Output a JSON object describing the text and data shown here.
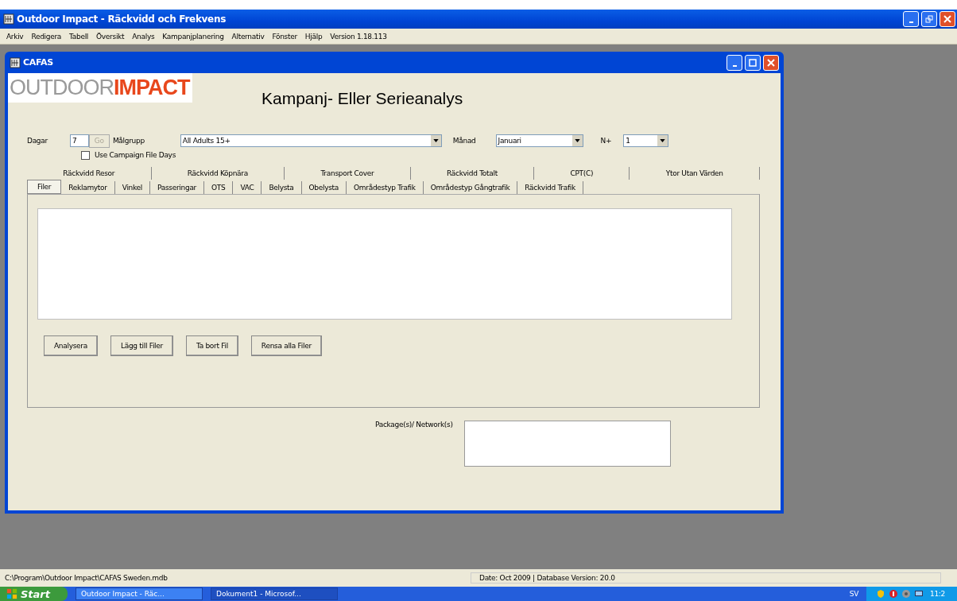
{
  "window": {
    "title": "Outdoor Impact - Räckvidd och Frekvens"
  },
  "menu": [
    "Arkiv",
    "Redigera",
    "Tabell",
    "Översikt",
    "Analys",
    "Kampanjplanering",
    "Alternativ",
    "Fönster",
    "Hjälp",
    "Version 1.18.113"
  ],
  "child_window": {
    "title": "CAFAS",
    "logo": "OUTDOOR**IMPACT**",
    "heading": "Kampanj- Eller Serieanalys",
    "dagar": {
      "label": "Dagar",
      "value": "7",
      "go": {
        "label": "Go",
        "disabled": true
      }
    },
    "malgrupp": {
      "label": "Målgrupp",
      "value": "All Adults 15+"
    },
    "manad": {
      "label": "Månad",
      "value": "Januari"
    },
    "n_plus": {
      "label": "N+",
      "value": "1"
    },
    "use_campaign_days": {
      "label": "Use Campaign File Days",
      "checked": false
    },
    "tabs_back": [
      {
        "label": "Räckvidd Resor",
        "selected": false
      },
      {
        "label": "Räckvidd Köpnära",
        "selected": false
      },
      {
        "label": "Transport Cover",
        "selected": false
      },
      {
        "label": "Räckvidd Totalt",
        "selected": false
      },
      {
        "label": "CPT(C)",
        "selected": false
      },
      {
        "label": "Ytor Utan Värden",
        "selected": false
      }
    ],
    "tabs_front": [
      {
        "label": "Filer",
        "selected": true
      },
      {
        "label": "Reklamytor",
        "selected": false
      },
      {
        "label": "Vinkel",
        "selected": false
      },
      {
        "label": "Passeringar",
        "selected": false
      },
      {
        "label": "OTS",
        "selected": false
      },
      {
        "label": "VAC",
        "selected": false
      },
      {
        "label": "Belysta",
        "selected": false
      },
      {
        "label": "Obelysta",
        "selected": false
      },
      {
        "label": "Områdestyp Trafik",
        "selected": false
      },
      {
        "label": "Områdestyp Gångtrafik",
        "selected": false
      },
      {
        "label": "Räckvidd Trafik",
        "selected": false
      }
    ],
    "buttons": [
      "Analysera",
      "Lägg till Filer",
      "Ta bort Fil",
      "Rensa alla Filer"
    ],
    "package_label": "Package(s)/ Network(s)"
  },
  "status_bar": {
    "path": "C:\\Program\\Outdoor Impact\\CAFAS Sweden.mdb",
    "date": "Date:  Oct 2009  |  Database Version:  20.0"
  },
  "taskbar": {
    "start": "Start",
    "items": [
      {
        "label": "Outdoor Impact - Räc...",
        "selected": false
      },
      {
        "label": "Dokument1 - Microsof...",
        "selected": true
      }
    ],
    "language": "SV",
    "clock": "11:2"
  }
}
